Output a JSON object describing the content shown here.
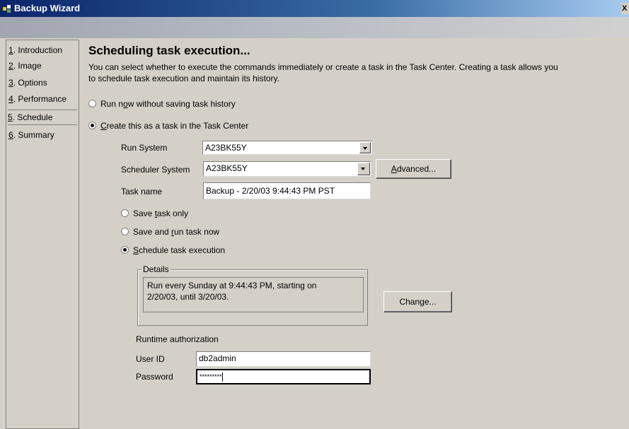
{
  "window": {
    "title": "Backup Wizard",
    "close_glyph": "X"
  },
  "sidebar": {
    "items": [
      {
        "num": "1",
        "label": ". Introduction"
      },
      {
        "num": "2",
        "label": ". Image"
      },
      {
        "num": "3",
        "label": ". Options"
      },
      {
        "num": "4",
        "label": ". Performance"
      },
      {
        "num": "5",
        "label": ". Schedule"
      },
      {
        "num": "6",
        "label": ". Summary"
      }
    ]
  },
  "main": {
    "heading": "Scheduling task execution...",
    "desc_line1": "You can select whether to execute the commands immediately or create a task in the Task Center. Creating a task allows you",
    "desc_line2": "to schedule task execution and maintain its history.",
    "run_now": {
      "pre": "Run n",
      "u": "o",
      "post": "w without saving task history",
      "checked": false
    },
    "create_task": {
      "pre": "",
      "u": "C",
      "post": "reate this as a task in the Task Center",
      "checked": true
    },
    "run_system": {
      "label": "Run System",
      "value": "A23BK55Y"
    },
    "scheduler_system": {
      "label": "Scheduler System",
      "value": "A23BK55Y"
    },
    "advanced_button": {
      "u": "A",
      "post": "dvanced..."
    },
    "task_name": {
      "label": "Task name",
      "value": "Backup - 2/20/03 9:44:43 PM PST"
    },
    "save_only": {
      "pre": "Save ",
      "u": "t",
      "post": "ask only",
      "checked": false
    },
    "save_run": {
      "pre": "Save and ",
      "u": "r",
      "post": "un task now",
      "checked": false
    },
    "schedule_exec": {
      "pre": "",
      "u": "S",
      "post": "chedule task execution",
      "checked": true
    },
    "details": {
      "legend": "Details",
      "line1": "Run every Sunday at 9:44:43 PM, starting on",
      "line2": "2/20/03, until 3/20/03."
    },
    "change_button": "Change...",
    "runtime_auth": "Runtime authorization",
    "user_id": {
      "label": "User ID",
      "value": "db2admin"
    },
    "password": {
      "label": "Password",
      "value": "*********"
    }
  },
  "colors": {
    "face": "#d4d0c8",
    "title_start": "#0a246a",
    "title_end": "#a6caf0"
  }
}
